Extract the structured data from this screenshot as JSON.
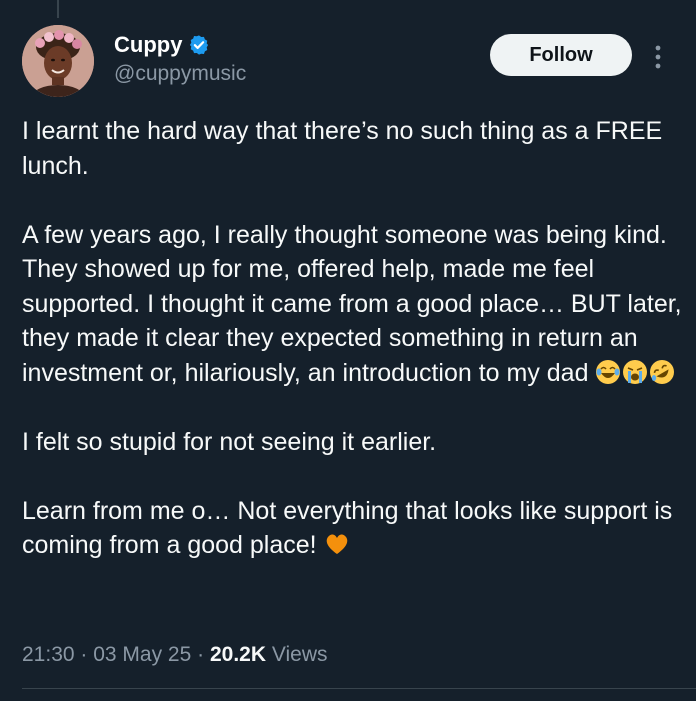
{
  "author": {
    "display_name": "Cuppy",
    "handle": "@cuppymusic",
    "verified": true,
    "verified_color": "#1d9bf0"
  },
  "follow_button": {
    "label": "Follow"
  },
  "more_menu": {
    "icon": "more-vertical-icon"
  },
  "tweet": {
    "paragraphs": [
      {
        "text": "I learnt the hard way that there’s no such thing as a FREE lunch."
      },
      {
        "text": "A few years ago, I really thought someone was being kind. They showed up for me, offered help, made me feel supported. I thought it came from a good place… BUT later, they made it clear they expected something in return an investment or, hilariously, an introduction to my dad"
      },
      {
        "text": "I felt so stupid for not seeing it earlier."
      },
      {
        "text": "Learn from me o… Not everything that looks like support is coming from a good place!"
      }
    ],
    "emojis_p2": [
      "face-with-tears-of-joy",
      "loudly-crying-face",
      "rolling-on-floor-laughing"
    ],
    "emoji_p4": "orange-heart"
  },
  "meta": {
    "time": "21:30",
    "sep1": " · ",
    "date": "03 May 25",
    "sep2": " · ",
    "views_count": "20.2K",
    "views_label": " Views"
  },
  "colors": {
    "background": "#15202b",
    "text": "#f7f9f9",
    "secondary": "#8b98a5",
    "divider": "#38444d"
  }
}
